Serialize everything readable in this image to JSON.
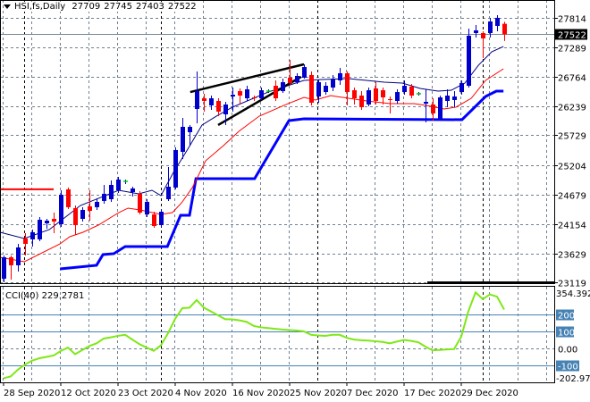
{
  "header": {
    "symbol": "HSI,fs,Daily",
    "open": "27709",
    "high": "27745",
    "low": "27403",
    "close": "27522"
  },
  "colors": {
    "bull": "#0000cc",
    "bear": "#ff0000",
    "doji": "#00cc00",
    "ma_fast": "#000080",
    "ma_slow": "#ff0000",
    "stop": "#0000ff",
    "cci": "#7fe817",
    "level": "#4682b4",
    "grid": "#708090"
  },
  "chart_data": [
    {
      "type": "candlestick",
      "title": "HSI,fs,Daily",
      "ohlc_fields": [
        "open",
        "high",
        "low",
        "close"
      ],
      "candles": [
        [
          23183,
          23595,
          23119,
          23563
        ],
        [
          23563,
          23595,
          23167,
          23421
        ],
        [
          23421,
          23801,
          23310,
          23738
        ],
        [
          23896,
          23992,
          23595,
          23801
        ],
        [
          23881,
          24055,
          23754,
          24007
        ],
        [
          23881,
          24277,
          23849,
          24229
        ],
        [
          24166,
          24245,
          24071,
          24213
        ],
        [
          24245,
          24356,
          23992,
          24198
        ],
        [
          24150,
          24753,
          24103,
          24673
        ],
        [
          24769,
          24800,
          24420,
          24452
        ],
        [
          24436,
          24483,
          23960,
          24134
        ],
        [
          24245,
          24452,
          24198,
          24404
        ],
        [
          24467,
          24753,
          24213,
          24388
        ],
        [
          24452,
          24610,
          24404,
          24547
        ],
        [
          24563,
          24848,
          24515,
          24690
        ],
        [
          24594,
          24927,
          24547,
          24848
        ],
        [
          24753,
          24991,
          24706,
          24943
        ],
        [
          24911,
          24943,
          24864,
          24911
        ],
        [
          24721,
          24816,
          24642,
          24785
        ],
        [
          24690,
          24737,
          24324,
          24356
        ],
        [
          24324,
          24594,
          24277,
          24547
        ],
        [
          24324,
          24372,
          24087,
          24118
        ],
        [
          24134,
          24420,
          24103,
          24372
        ],
        [
          24594,
          25165,
          24563,
          24816
        ],
        [
          24801,
          25514,
          24769,
          25467
        ],
        [
          25435,
          26038,
          25308,
          25879
        ],
        [
          25784,
          25911,
          25546,
          25879
        ],
        [
          26196,
          26862,
          25942,
          26513
        ],
        [
          26386,
          26466,
          26149,
          26339
        ],
        [
          26260,
          26434,
          26180,
          26386
        ],
        [
          26339,
          26386,
          26069,
          26149
        ],
        [
          26101,
          26323,
          25911,
          26276
        ],
        [
          26418,
          26577,
          26149,
          26450
        ],
        [
          26513,
          26561,
          26276,
          26434
        ],
        [
          26386,
          26608,
          26339,
          26545
        ],
        [
          26402,
          26434,
          26339,
          26386
        ],
        [
          26386,
          26577,
          26355,
          26529
        ],
        [
          26513,
          26545,
          26482,
          26513
        ],
        [
          26608,
          26704,
          26339,
          26386
        ],
        [
          26513,
          26735,
          26482,
          26672
        ],
        [
          26751,
          27068,
          26624,
          26656
        ],
        [
          26672,
          26831,
          26640,
          26783
        ],
        [
          26751,
          26989,
          26735,
          26941
        ],
        [
          26799,
          26862,
          26260,
          26307
        ],
        [
          26418,
          26719,
          26307,
          26672
        ],
        [
          26497,
          26672,
          26450,
          26608
        ],
        [
          26577,
          26799,
          26513,
          26719
        ],
        [
          26704,
          26926,
          26624,
          26831
        ],
        [
          26831,
          26862,
          26260,
          26497
        ],
        [
          26529,
          26577,
          26276,
          26386
        ],
        [
          26434,
          26513,
          26180,
          26228
        ],
        [
          26276,
          26577,
          26244,
          26529
        ],
        [
          26561,
          26672,
          26276,
          26339
        ],
        [
          26529,
          26577,
          26276,
          26402
        ],
        [
          26371,
          26418,
          26117,
          26355
        ],
        [
          26339,
          26545,
          26291,
          26497
        ],
        [
          26497,
          26704,
          26450,
          26608
        ],
        [
          26593,
          26640,
          26386,
          26434
        ],
        [
          26466,
          26497,
          26434,
          26466
        ],
        [
          26291,
          26545,
          25958,
          26323
        ],
        [
          26276,
          26386,
          25990,
          26117
        ],
        [
          26022,
          26434,
          25990,
          26402
        ],
        [
          26339,
          26545,
          26228,
          26434
        ],
        [
          26355,
          26513,
          26228,
          26418
        ],
        [
          26497,
          26704,
          26450,
          26656
        ],
        [
          26608,
          27624,
          26577,
          27497
        ],
        [
          27544,
          27687,
          27465,
          27592
        ],
        [
          27544,
          27576,
          27100,
          27449
        ],
        [
          27544,
          27814,
          27465,
          27750
        ],
        [
          27671,
          27861,
          27576,
          27814
        ],
        [
          27709,
          27745,
          27403,
          27522
        ]
      ],
      "ma_fast": [
        [
          -0.5,
          24007
        ],
        [
          2.9,
          23896
        ],
        [
          6.4,
          24055
        ],
        [
          10.75,
          24483
        ],
        [
          16.1,
          24753
        ],
        [
          18.9,
          24690
        ],
        [
          20.75,
          24753
        ],
        [
          22,
          24658
        ],
        [
          23.75,
          25070
        ],
        [
          25.75,
          25482
        ],
        [
          27.75,
          25911
        ],
        [
          29.75,
          26069
        ],
        [
          32,
          26228
        ],
        [
          37,
          26497
        ],
        [
          42,
          26704
        ],
        [
          44.5,
          26720
        ],
        [
          48.25,
          26735
        ],
        [
          50.75,
          26704
        ],
        [
          53.25,
          26672
        ],
        [
          55.75,
          26656
        ],
        [
          58.25,
          26561
        ],
        [
          60.75,
          26513
        ],
        [
          62.6,
          26529
        ],
        [
          64.5,
          26656
        ],
        [
          66.4,
          26973
        ],
        [
          68.25,
          27211
        ],
        [
          69.9,
          27306
        ]
      ],
      "ma_slow": [
        [
          -0.5,
          23563
        ],
        [
          2.9,
          23484
        ],
        [
          7.9,
          23801
        ],
        [
          9.25,
          23928
        ],
        [
          11.1,
          24007
        ],
        [
          13.25,
          24134
        ],
        [
          16.1,
          24356
        ],
        [
          17.4,
          24436
        ],
        [
          19.1,
          24404
        ],
        [
          22,
          24324
        ],
        [
          23.6,
          24356
        ],
        [
          24.9,
          24531
        ],
        [
          26.4,
          24801
        ],
        [
          28.25,
          25276
        ],
        [
          30.75,
          25546
        ],
        [
          32.9,
          25800
        ],
        [
          35.75,
          26069
        ],
        [
          39.5,
          26276
        ],
        [
          42,
          26402
        ],
        [
          43.6,
          26355
        ],
        [
          45.75,
          26434
        ],
        [
          48.25,
          26386
        ],
        [
          50.75,
          26339
        ],
        [
          54.1,
          26291
        ],
        [
          57.4,
          26291
        ],
        [
          59.1,
          26260
        ],
        [
          61.6,
          26196
        ],
        [
          63.25,
          26228
        ],
        [
          65.4,
          26386
        ],
        [
          67.4,
          26704
        ],
        [
          69.9,
          26910
        ]
      ],
      "trailing_stop": [
        [
          7.9,
          23357
        ],
        [
          13,
          23421
        ],
        [
          13.9,
          23611
        ],
        [
          15.4,
          23627
        ],
        [
          17,
          23754
        ],
        [
          22.9,
          23754
        ],
        [
          24.75,
          24309
        ],
        [
          26,
          24309
        ],
        [
          26.9,
          24959
        ],
        [
          35.1,
          24959
        ],
        [
          39.9,
          25990
        ],
        [
          42,
          26022
        ],
        [
          64.1,
          26006
        ],
        [
          67.4,
          26418
        ],
        [
          68.9,
          26513
        ],
        [
          69.9,
          26513
        ]
      ],
      "horizontal_level": {
        "price": 24770,
        "from": -0.5,
        "to": 7
      },
      "trendlines": [
        [
          [
            26.1,
            26497
          ],
          [
            42,
            26989
          ]
        ],
        [
          [
            30,
            25911
          ],
          [
            41.6,
            26767
          ]
        ]
      ],
      "current_price": 27522,
      "current_price_label": "27522",
      "y_ticks": [
        "27814",
        "27289",
        "26764",
        "26239",
        "25729",
        "25204",
        "24679",
        "24154",
        "23629",
        "23119"
      ],
      "ylim": [
        23119,
        27814
      ],
      "x_ticks": [
        {
          "index": 0,
          "label": "28 Sep 2020"
        },
        {
          "index": 8,
          "label": "12 Oct 2020"
        },
        {
          "index": 16,
          "label": "23 Oct 2020"
        },
        {
          "index": 24,
          "label": "4 Nov 2020"
        },
        {
          "index": 32,
          "label": "16 Nov 2020"
        },
        {
          "index": 40,
          "label": "25 Nov 2020"
        },
        {
          "index": 48,
          "label": "7 Dec 2020"
        },
        {
          "index": 56,
          "label": "17 Dec 2020"
        },
        {
          "index": 64,
          "label": "29 Dec 2020"
        }
      ],
      "period_separators": [
        2.9,
        22,
        43.9,
        67
      ]
    },
    {
      "type": "line",
      "title": "CCI(40) 229.2781",
      "name": "CCI(40)",
      "last_value": "229.2781",
      "values": [
        -176,
        -165,
        -125,
        -95,
        -72,
        -58,
        -50,
        -42,
        -15,
        5,
        -34,
        -10,
        14,
        30,
        58,
        65,
        74,
        80,
        52,
        25,
        5,
        -14,
        18,
        90,
        175,
        237,
        240,
        285,
        240,
        218,
        195,
        172,
        171,
        165,
        156,
        132,
        124,
        120,
        115,
        111,
        108,
        105,
        100,
        80,
        76,
        74,
        80,
        80,
        62,
        52,
        48,
        46,
        42,
        38,
        30,
        40,
        50,
        44,
        36,
        10,
        -11,
        -9,
        -6,
        -4,
        70,
        220,
        330,
        290,
        318,
        305,
        229
      ],
      "levels": [
        200,
        100,
        0,
        -100
      ],
      "level_labels": [
        "200",
        "100",
        "0.00",
        "-100"
      ],
      "max_label": "354.3924",
      "min_label": "-202.9734",
      "ylim": [
        -202.9734,
        354.3924
      ]
    }
  ]
}
